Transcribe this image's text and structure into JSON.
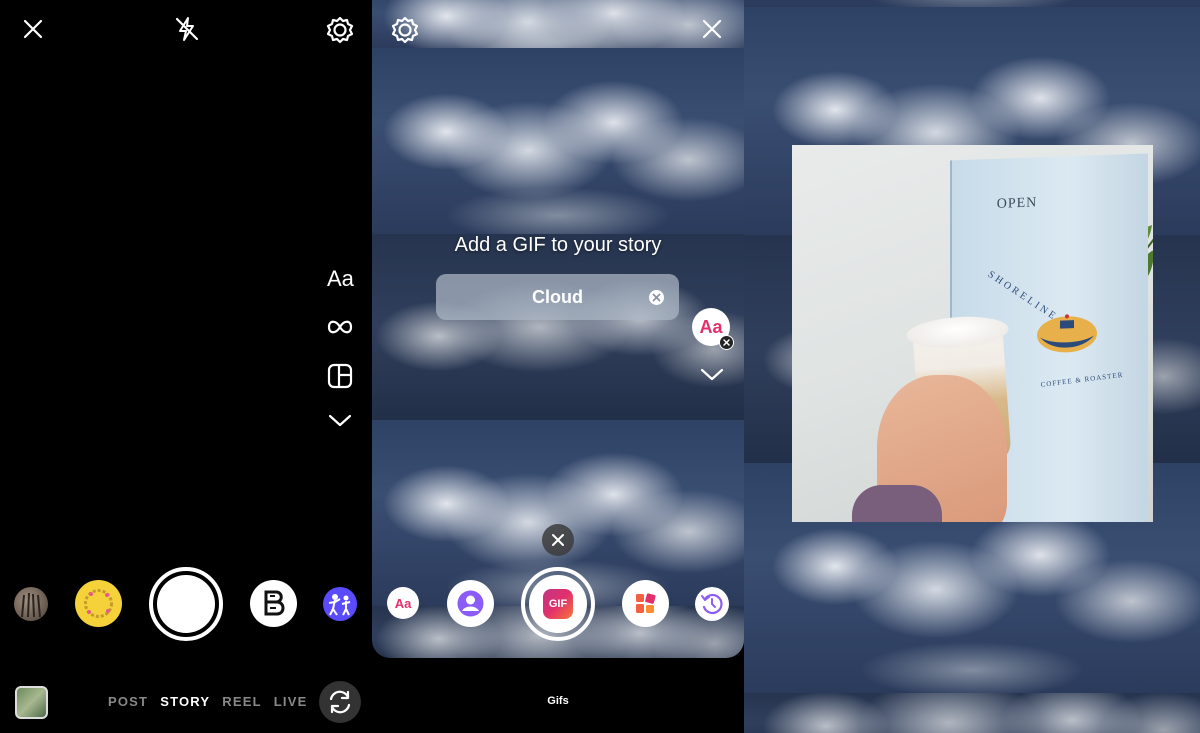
{
  "camera": {
    "modes": [
      "POST",
      "STORY",
      "REEL",
      "LIVE"
    ],
    "active_mode": "STORY",
    "side_tools": [
      "text-tool-icon",
      "boomerang-icon",
      "layout-icon",
      "chevron-down-icon"
    ],
    "text_tool_label": "Aa"
  },
  "gif_picker": {
    "title": "Add a GIF to your story",
    "search_value": "Cloud",
    "tray_label": "Gifs",
    "text_style_label": "Aa",
    "gif_button_label": "GIF",
    "tray_items": [
      "text-style-icon",
      "avatar-sticker-icon",
      "gif-icon",
      "templates-icon",
      "history-icon"
    ]
  },
  "photo_sticker": {
    "box_text": "OPEN",
    "brand": "SHORELINE",
    "subtitle": "COFFEE & ROASTER"
  },
  "colors": {
    "background": "#000000",
    "accent_gif": "#e1306c",
    "sky": "#2e4266",
    "effect_purple": "#5b4bff"
  }
}
